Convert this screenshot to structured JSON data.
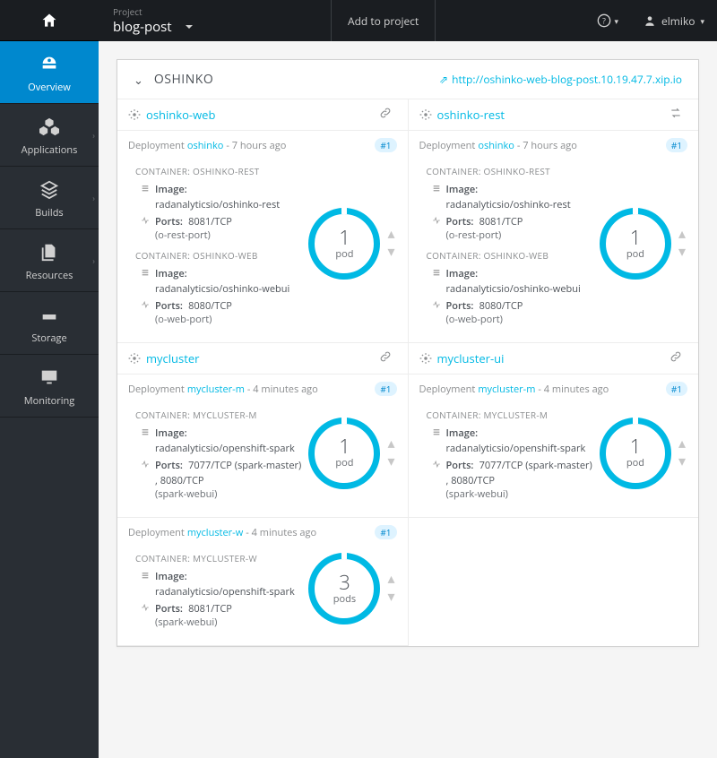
{
  "header": {
    "project_hint": "Project",
    "project_name": "blog-post",
    "add_to_project": "Add to project",
    "user": "elmiko"
  },
  "sidebar": {
    "overview": "Overview",
    "applications": "Applications",
    "builds": "Builds",
    "resources": "Resources",
    "storage": "Storage",
    "monitoring": "Monitoring"
  },
  "app": {
    "name": "OSHINKO",
    "url": "http://oshinko-web-blog-post.10.19.47.7.xip.io",
    "url_icon": "⇗"
  },
  "services": [
    {
      "name": "oshinko-web",
      "right_icon": "link",
      "deployment": {
        "label": "Deployment",
        "link": "oshinko",
        "age": "7 hours ago",
        "badge": "#1"
      },
      "pod": {
        "count": "1",
        "unit": "pod"
      },
      "containers": [
        {
          "name": "CONTAINER: OSHINKO-REST",
          "image": "radanalyticsio/oshinko-rest",
          "ports": "8081/TCP",
          "ports_sub": "(o-rest-port)"
        },
        {
          "name": "CONTAINER: OSHINKO-WEB",
          "image": "radanalyticsio/oshinko-webui",
          "ports": "8080/TCP",
          "ports_sub": "(o-web-port)"
        }
      ]
    },
    {
      "name": "oshinko-rest",
      "right_icon": "swap",
      "deployment": {
        "label": "Deployment",
        "link": "oshinko",
        "age": "7 hours ago",
        "badge": "#1"
      },
      "pod": {
        "count": "1",
        "unit": "pod"
      },
      "containers": [
        {
          "name": "CONTAINER: OSHINKO-REST",
          "image": "radanalyticsio/oshinko-rest",
          "ports": "8081/TCP",
          "ports_sub": "(o-rest-port)"
        },
        {
          "name": "CONTAINER: OSHINKO-WEB",
          "image": "radanalyticsio/oshinko-webui",
          "ports": "8080/TCP",
          "ports_sub": "(o-web-port)"
        }
      ]
    },
    {
      "name": "mycluster",
      "right_icon": "link",
      "deployment": {
        "label": "Deployment",
        "link": "mycluster-m",
        "age": "4 minutes ago",
        "badge": "#1"
      },
      "pod": {
        "count": "1",
        "unit": "pod"
      },
      "containers": [
        {
          "name": "CONTAINER: MYCLUSTER-M",
          "image": "radanalyticsio/openshift-spark",
          "ports": "7077/TCP (spark-master) , 8080/TCP",
          "ports_sub": "(spark-webui)"
        }
      ]
    },
    {
      "name": "mycluster-ui",
      "right_icon": "link",
      "deployment": {
        "label": "Deployment",
        "link": "mycluster-m",
        "age": "4 minutes ago",
        "badge": "#1"
      },
      "pod": {
        "count": "1",
        "unit": "pod"
      },
      "containers": [
        {
          "name": "CONTAINER: MYCLUSTER-M",
          "image": "radanalyticsio/openshift-spark",
          "ports": "7077/TCP (spark-master) , 8080/TCP",
          "ports_sub": "(spark-webui)"
        }
      ]
    },
    {
      "name": "",
      "right_icon": "",
      "deployment": {
        "label": "Deployment",
        "link": "mycluster-w",
        "age": "4 minutes ago",
        "badge": "#1"
      },
      "pod": {
        "count": "3",
        "unit": "pods"
      },
      "containers": [
        {
          "name": "CONTAINER: MYCLUSTER-W",
          "image": "radanalyticsio/openshift-spark",
          "ports": "8081/TCP",
          "ports_sub": "(spark-webui)"
        }
      ]
    }
  ],
  "labels": {
    "image": "Image:",
    "ports": "Ports:"
  }
}
